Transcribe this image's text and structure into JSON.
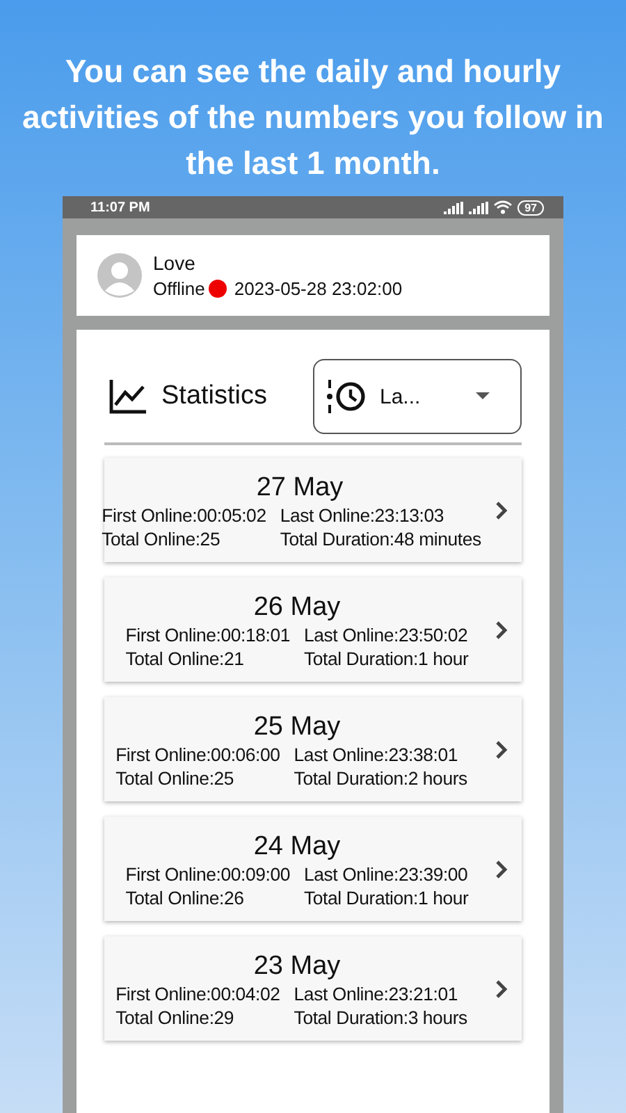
{
  "headline": "You can see the daily and hourly activities of the numbers you follow in the last 1 month.",
  "status_bar": {
    "time": "11:07 PM",
    "battery": "97"
  },
  "contact": {
    "name": "Love",
    "status": "Offline",
    "online": false,
    "last_seen": "2023-05-28 23:02:00"
  },
  "statistics": {
    "title": "Statistics",
    "dropdown": {
      "value": "La..."
    }
  },
  "days": [
    {
      "date": "27 May",
      "first_online": "First Online:00:05:02",
      "last_online": "Last Online:23:13:03",
      "total_online": "Total Online:25",
      "total_duration": "Total Duration:48 minutes"
    },
    {
      "date": "26 May",
      "first_online": "First Online:00:18:01",
      "last_online": "Last Online:23:50:02",
      "total_online": "Total Online:21",
      "total_duration": "Total Duration:1 hour"
    },
    {
      "date": "25 May",
      "first_online": "First Online:00:06:00",
      "last_online": "Last Online:23:38:01",
      "total_online": "Total Online:25",
      "total_duration": "Total Duration:2 hours"
    },
    {
      "date": "24 May",
      "first_online": "First Online:00:09:00",
      "last_online": "Last Online:23:39:00",
      "total_online": "Total Online:26",
      "total_duration": "Total Duration:1 hour"
    },
    {
      "date": "23 May",
      "first_online": "First Online:00:04:02",
      "last_online": "Last Online:23:21:01",
      "total_online": "Total Online:29",
      "total_duration": "Total Duration:3 hours"
    }
  ]
}
